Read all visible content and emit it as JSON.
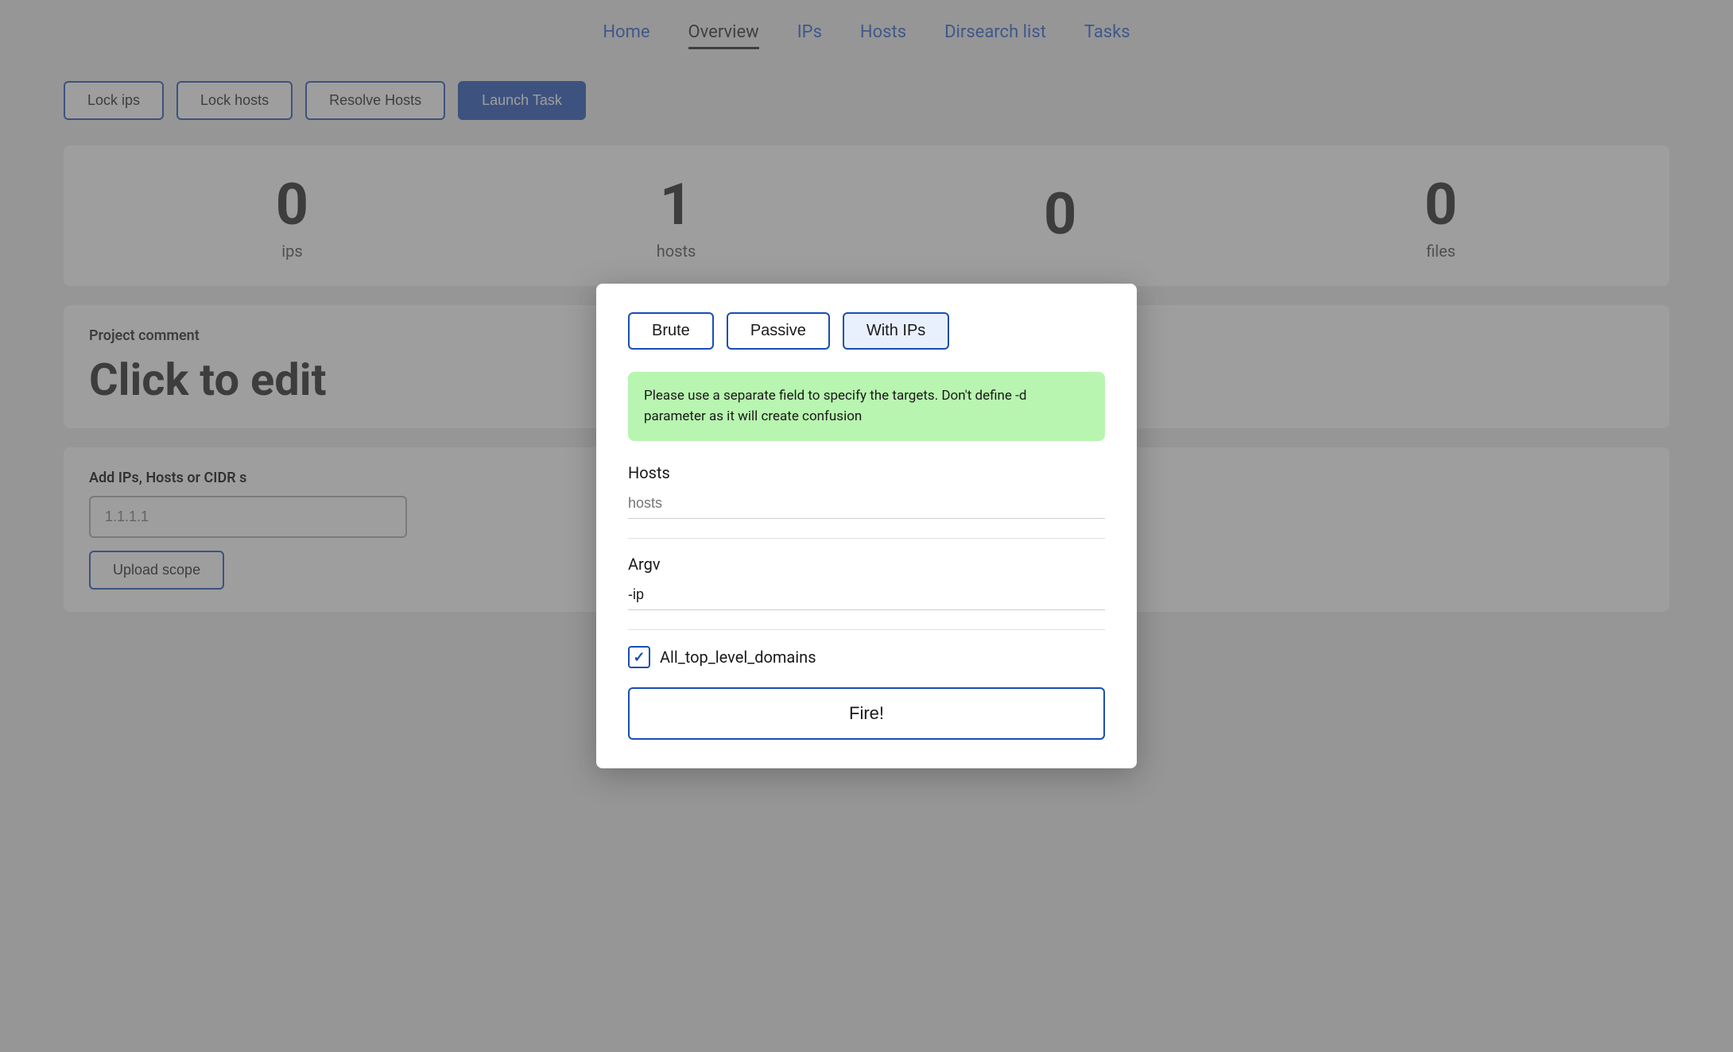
{
  "nav": {
    "items": [
      {
        "label": "Home",
        "active": false
      },
      {
        "label": "Overview",
        "active": true
      },
      {
        "label": "IPs",
        "active": false
      },
      {
        "label": "Hosts",
        "active": false
      },
      {
        "label": "Dirsearch list",
        "active": false
      },
      {
        "label": "Tasks",
        "active": false
      }
    ]
  },
  "action_bar": {
    "lock_ips": "Lock ips",
    "lock_hosts": "Lock hosts",
    "resolve_hosts": "Resolve Hosts",
    "launch_task": "Launch Task"
  },
  "stats": {
    "ips_count": "0",
    "ips_label": "ips",
    "hosts_count": "1",
    "hosts_label": "hosts",
    "other_count": "0",
    "other_label": "",
    "files_count": "0",
    "files_label": "files"
  },
  "project": {
    "comment_label": "Project comment",
    "comment_value": "Click to edit"
  },
  "add_section": {
    "label": "Add IPs, Hosts or CIDR s",
    "input_placeholder": "1.1.1.1",
    "upload_scope": "Upload scope"
  },
  "modal": {
    "tabs": [
      {
        "label": "Brute",
        "active": false
      },
      {
        "label": "Passive",
        "active": false
      },
      {
        "label": "With IPs",
        "active": true
      }
    ],
    "info_text": "Please use a separate field to specify the targets. Don't define -d parameter as it will create confusion",
    "hosts_label": "Hosts",
    "hosts_placeholder": "hosts",
    "argv_label": "Argv",
    "argv_value": "-ip",
    "checkbox_label": "All_top_level_domains",
    "checkbox_checked": true,
    "fire_button": "Fire!"
  }
}
